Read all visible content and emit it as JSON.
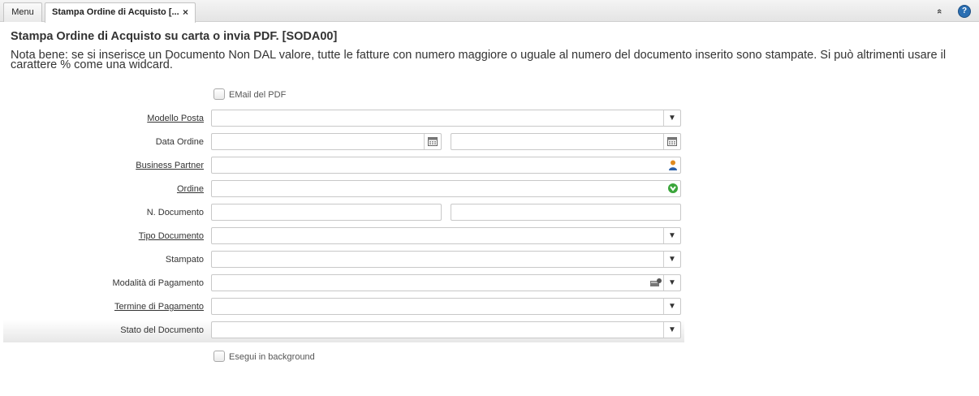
{
  "tabs": [
    {
      "label": "Menu"
    },
    {
      "label": "Stampa Ordine di Acquisto [..."
    }
  ],
  "icons": {
    "close": "×",
    "collapse": "«",
    "help": "?"
  },
  "page": {
    "title": "Stampa Ordine di Acquisto su carta o invia PDF. [SODA00]",
    "note": "Nota bene: se si inserisce un Documento Non DAL valore, tutte le fatture con numero maggiore o uguale al numero del documento inserito sono stampate. Si può altrimenti usare il carattere % come una widcard."
  },
  "form": {
    "email_pdf": {
      "label": "EMail del PDF",
      "checked": false
    },
    "modello_posta": {
      "label": "Modello Posta",
      "value": ""
    },
    "data_ordine": {
      "label": "Data Ordine",
      "from": "",
      "to": ""
    },
    "business_partner": {
      "label": "Business Partner",
      "value": ""
    },
    "ordine": {
      "label": "Ordine",
      "value": ""
    },
    "n_documento": {
      "label": "N. Documento",
      "from": "",
      "to": ""
    },
    "tipo_documento": {
      "label": "Tipo Documento",
      "value": ""
    },
    "stampato": {
      "label": "Stampato",
      "value": ""
    },
    "modalita_pagamento": {
      "label": "Modalità di Pagamento",
      "value": ""
    },
    "termine_pagamento": {
      "label": "Termine di Pagamento",
      "value": ""
    },
    "stato_documento": {
      "label": "Stato del Documento",
      "value": ""
    },
    "background": {
      "label": "Esegui in background",
      "checked": false
    }
  },
  "colors": {
    "help_icon": "#2a6fb3",
    "partner_icon": "#e08a1e",
    "order_icon": "#3aa53a"
  }
}
